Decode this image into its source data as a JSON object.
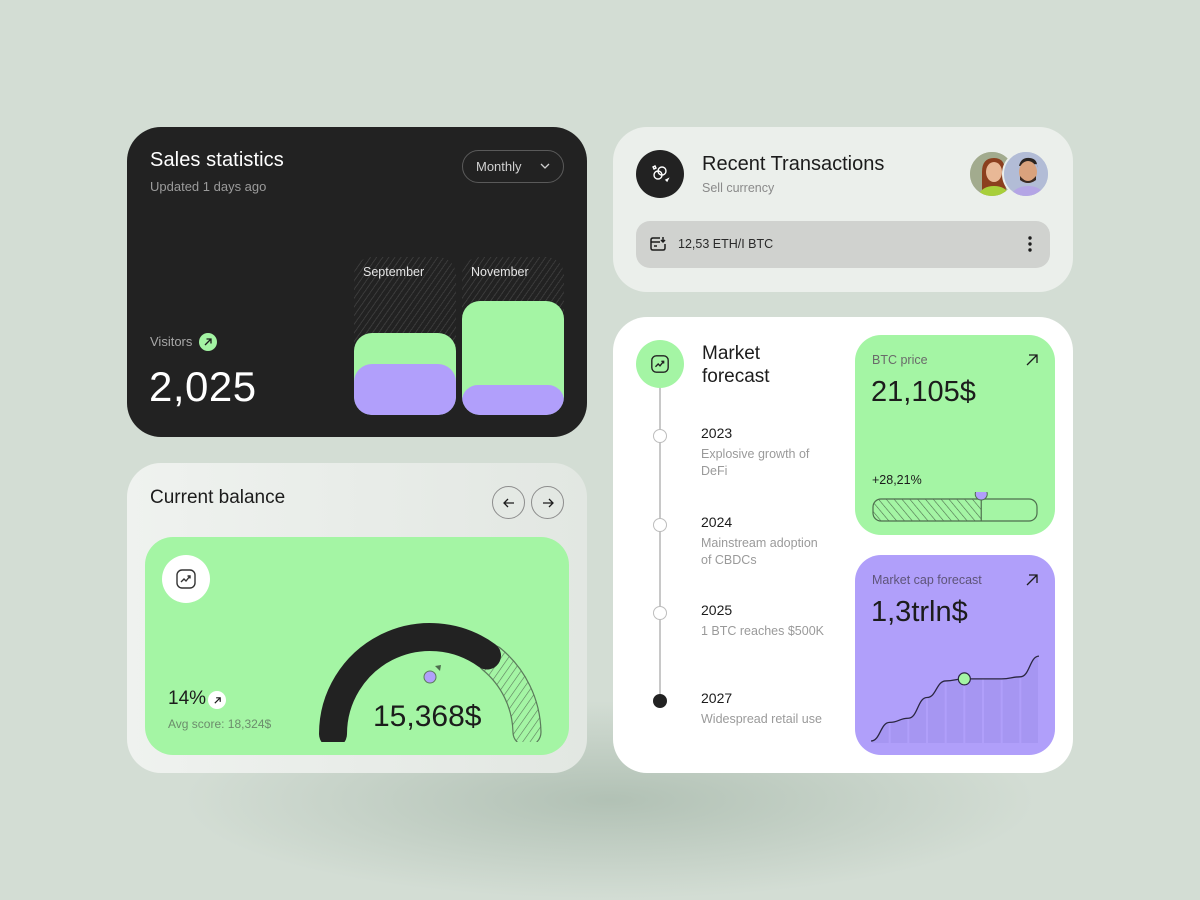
{
  "colors": {
    "background": "#d3ddd4",
    "dark": "#222222",
    "green": "#a4f5a4",
    "purple": "#b09ffa",
    "white": "#ffffff"
  },
  "sales": {
    "title": "Sales statistics",
    "subtitle": "Updated 1 days ago",
    "period": "Monthly",
    "visitors_label": "Visitors",
    "visitors_value": "2,025",
    "icons": {
      "dropdown": "chevron-down-icon",
      "trend": "arrow-up-right-icon"
    },
    "chart_data": {
      "type": "bar",
      "categories": [
        "September",
        "November"
      ],
      "series": [
        {
          "name": "green",
          "values": [
            52,
            72
          ]
        },
        {
          "name": "purple",
          "values": [
            32,
            19
          ]
        }
      ],
      "ylim": [
        0,
        100
      ]
    }
  },
  "transactions": {
    "title": "Recent Transactions",
    "subtitle": "Sell currency",
    "item": "12,53 ETH/I BTC",
    "icons": {
      "header": "currency-exchange-icon",
      "item": "card-receive-icon",
      "more": "more-vertical-icon"
    },
    "avatars": [
      "avatar-woman",
      "avatar-man"
    ]
  },
  "balance": {
    "title": "Current balance",
    "icons": {
      "prev": "arrow-left-icon",
      "next": "arrow-right-icon",
      "card": "trend-up-icon"
    },
    "percent": "14%",
    "avg": "Avg score: 18,324$",
    "value": "15,368$",
    "gauge_fill": 0.7
  },
  "forecast": {
    "title_line1": "Market",
    "title_line2": "forecast",
    "timeline": [
      {
        "year": "2023",
        "desc": "Explosive growth of DeFi",
        "done": false
      },
      {
        "year": "2024",
        "desc": "Mainstream adoption of CBDCs",
        "done": false
      },
      {
        "year": "2025",
        "desc": "1 BTC reaches $500K",
        "done": false
      },
      {
        "year": "2027",
        "desc": "Widespread retail use",
        "done": true
      }
    ],
    "btc": {
      "label": "BTC price",
      "value": "21,105$",
      "change": "+28,21%",
      "progress": 0.66
    },
    "mcap": {
      "label": "Market cap forecast",
      "value": "1,3trln$",
      "chart_data": {
        "type": "area",
        "values": [
          0,
          18,
          22,
          42,
          58,
          60,
          60,
          60,
          62,
          82
        ],
        "highlight_index": 5
      }
    }
  }
}
